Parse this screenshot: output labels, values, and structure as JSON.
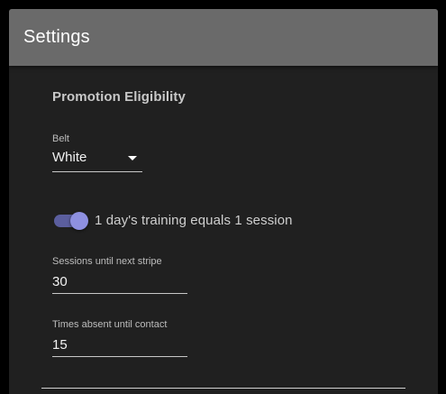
{
  "header": {
    "title": "Settings"
  },
  "promotion": {
    "section_title": "Promotion Eligibility",
    "belt": {
      "label": "Belt",
      "value": "White"
    },
    "training_toggle": {
      "label": "1 day's training equals 1 session",
      "checked": true,
      "accent_color": "#8e90e0"
    },
    "sessions_until_stripe": {
      "label": "Sessions until next stripe",
      "value": "30"
    },
    "times_absent": {
      "label": "Times absent until contact",
      "value": "15"
    }
  },
  "colors": {
    "header_bg": "#6a6a6a",
    "panel_bg": "#202020",
    "page_bg": "#000000"
  },
  "icons": {
    "belt_dropdown": "caret-down-icon"
  }
}
